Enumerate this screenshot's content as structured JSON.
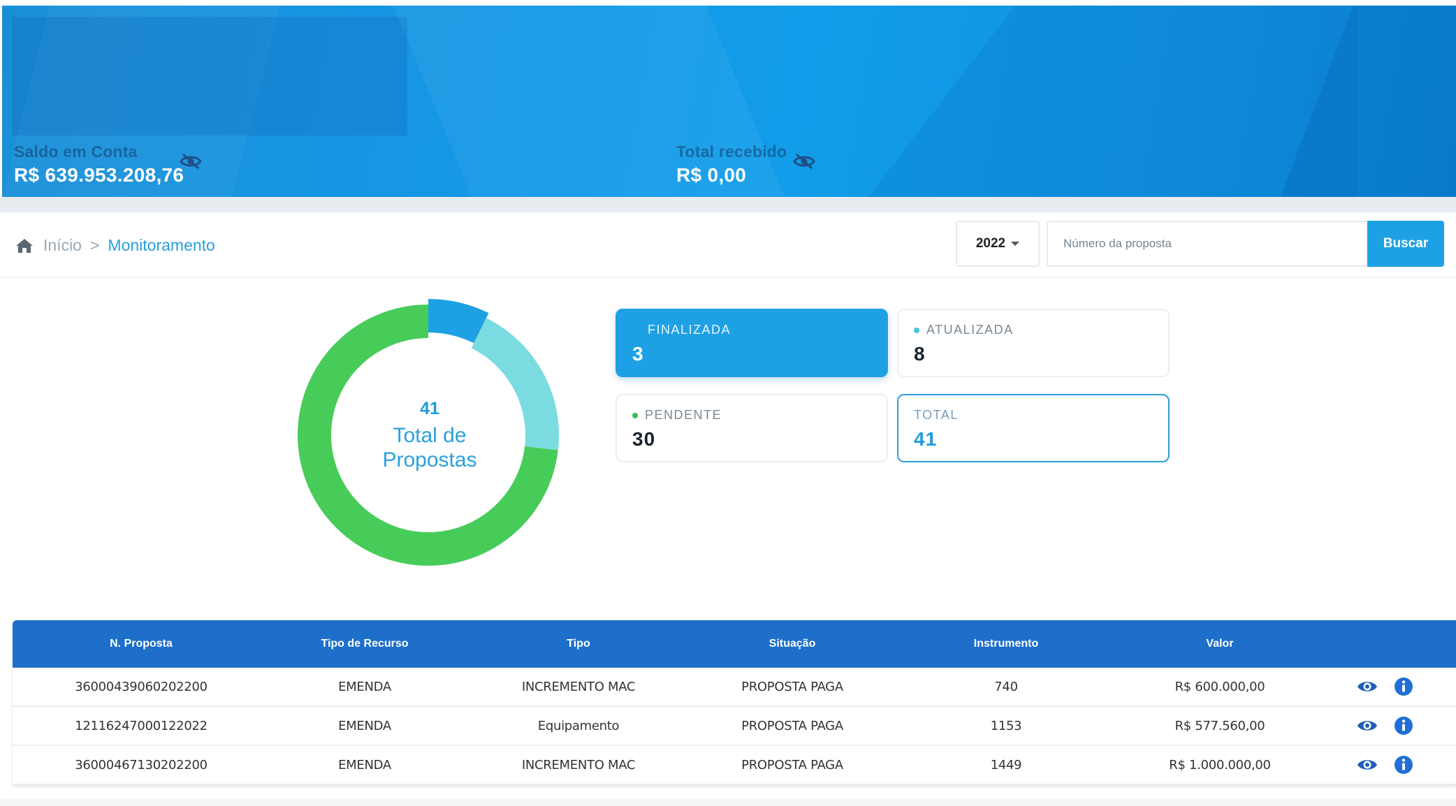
{
  "header": {
    "balance": {
      "label": "Saldo em Conta",
      "value": "R$ 639.953.208,76",
      "icon": "eye-slash-icon"
    },
    "received": {
      "label": "Total recebido",
      "value": "R$ 0,00",
      "icon": "eye-slash-icon"
    }
  },
  "breadcrumb": {
    "icon": "home-icon",
    "home": "Início",
    "separator": ">",
    "current": "Monitoramento"
  },
  "filters": {
    "year": "2022",
    "search_placeholder": "Número da proposta",
    "search_button": "Buscar"
  },
  "chart_data": {
    "type": "pie",
    "categories": [
      "FINALIZADA",
      "ATUALIZADA",
      "PENDENTE"
    ],
    "values": [
      3,
      8,
      30
    ],
    "colors": [
      "#1ea1e4",
      "#7adce0",
      "#47cc5a"
    ],
    "center_value": "41",
    "center_label": "Total de Propostas"
  },
  "cards": {
    "finalizada": {
      "label": "FINALIZADA",
      "count": "3"
    },
    "atualizada": {
      "label": "ATUALIZADA",
      "count": "8",
      "dot_color": "#45c3d6"
    },
    "pendente": {
      "label": "PENDENTE",
      "count": "30",
      "dot_color": "#3bbf55"
    },
    "total": {
      "label": "TOTAL",
      "count": "41"
    }
  },
  "table": {
    "columns": [
      "N. Proposta",
      "Tipo de Recurso",
      "Tipo",
      "Situação",
      "Instrumento",
      "Valor"
    ],
    "rows": [
      [
        "36000439060202200",
        "EMENDA",
        "INCREMENTO MAC",
        "PROPOSTA PAGA",
        "740",
        "R$ 600.000,00"
      ],
      [
        "12116247000122022",
        "EMENDA",
        "Equipamento",
        "PROPOSTA PAGA",
        "1153",
        "R$ 577.560,00"
      ],
      [
        "36000467130202200",
        "EMENDA",
        "INCREMENTO MAC",
        "PROPOSTA PAGA",
        "1449",
        "R$ 1.000.000,00"
      ]
    ],
    "row_icons": [
      "eye-icon",
      "info-icon"
    ]
  },
  "colors": {
    "primary": "#1ea1e4",
    "table_header": "#1d6fca"
  }
}
